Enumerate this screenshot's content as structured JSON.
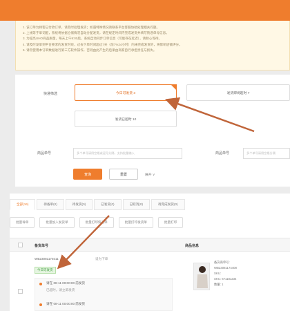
{
  "notice": {
    "lines": [
      "1. 该订单为顾客已付款订单，请及时处理发货；如遇特殊情况请联系平台客服协助处理相关问题。",
      "2. 上线等于单词配，系统将依据仓储情况自动分配发货，请在规定时间内完成发货并填写快递单号信息。",
      "3. 为提高UHO商品质量，每天上午9:00后，系统自动同步订单信息（可能存在延迟），请耐心等待。",
      "4. 请及时发单到平台要求的发货时效，过去下单时间超过7天（前7%24小时）内未完成发货的，将影响店铺评分。",
      "5. 请勿使用本订单数据进行第三方软件操作，否则由此产生的后果由商家自行承担责任与损失。"
    ]
  },
  "filters": {
    "quick_label": "快递筛选",
    "chips": [
      "今日可发货 3",
      "发货即将超时 7",
      "发货已超时 10"
    ],
    "order_label": "商品单号",
    "order_placeholder": "多个单号请用空格或逗号分隔，支持批量输入",
    "right_label": "商品单号",
    "right_placeholder": "多个单号请用空格分隔",
    "query_button": "查询",
    "reset_button": "重置",
    "expand_link": "展开 ∨"
  },
  "tabs": [
    "全部(16)",
    "待备单(0)",
    "待发货(0)",
    "已发货(0)",
    "已取消(0)",
    "待完成发货(0)"
  ],
  "actions": [
    "批量导单",
    "批量加入发货单",
    "批量打印快递单",
    "批量打印发货单",
    "批量打印"
  ],
  "table": {
    "col_order": "备货单号",
    "col_product": "商品信息",
    "row": {
      "order_no": "WB23081174011",
      "order_link": "设为下单",
      "tag": "今日可发货",
      "sub_time": "请在 08-11 00:00:00 前发货",
      "sub_hint": "已超时，请立即发货",
      "sub_time_2": "请在 08-11 00:00:00 前发货",
      "product_lines": [
        "备货商单号:",
        "WB23081174408",
        "SKU:",
        "SKC: 671181234",
        "数量: 1"
      ]
    }
  },
  "colors": {
    "accent": "#ef7d2d",
    "annotation_arrow": "#c0653a"
  }
}
